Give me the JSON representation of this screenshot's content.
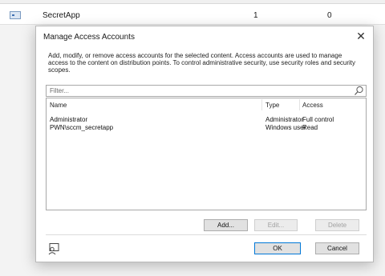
{
  "background": {
    "row": {
      "name": "SecretApp",
      "col1": "1",
      "col2": "0"
    }
  },
  "dialog": {
    "title": "Manage Access Accounts",
    "close_glyph": "✕",
    "description": "Add, modify, or remove access accounts for the selected content.  Access accounts are used to manage access to the content on distribution points. To control administrative security, use security roles and security scopes.",
    "filter": {
      "placeholder": "Filter...",
      "value": ""
    },
    "columns": [
      "Name",
      "Type",
      "Access"
    ],
    "rows": [
      {
        "name": "Administrator",
        "type": "Administrator",
        "access": "Full control"
      },
      {
        "name": "PWN\\sccm_secretapp",
        "type": "Windows user",
        "access": "Read"
      }
    ],
    "buttons": {
      "add": "Add...",
      "edit": "Edit...",
      "delete": "Delete",
      "ok": "OK",
      "cancel": "Cancel"
    },
    "icons": {
      "search": "search-icon",
      "help_person": "person-search-icon"
    }
  },
  "colors": {
    "accent_border": "#0078d7"
  }
}
